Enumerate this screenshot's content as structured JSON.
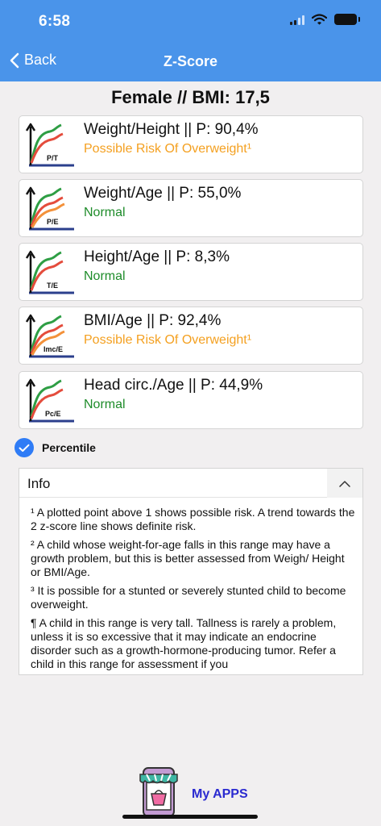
{
  "status_bar": {
    "time": "6:58"
  },
  "nav": {
    "back_label": "Back",
    "title": "Z-Score"
  },
  "page_title": "Female // BMI: 17,5",
  "colors": {
    "header": "#4a94ea",
    "normal": "#1e8c2a",
    "risk": "#f4a020",
    "checkbox": "#2f7cf6",
    "apps_link": "#2a2ad0"
  },
  "cards": [
    {
      "icon_label": "P/T",
      "title": "Weight/Height  ||  P: 90,4%",
      "status": "Possible Risk Of Overweight¹",
      "status_type": "risk",
      "icon": "growth-chart-icon"
    },
    {
      "icon_label": "P/E",
      "title": "Weight/Age  ||  P: 55,0%",
      "status": "Normal",
      "status_type": "normal",
      "icon": "growth-chart-icon"
    },
    {
      "icon_label": "T/E",
      "title": "Height/Age  ||  P: 8,3%",
      "status": "Normal",
      "status_type": "normal",
      "icon": "growth-chart-icon"
    },
    {
      "icon_label": "Imc/E",
      "title": "BMI/Age   ||  P: 92,4%",
      "status": "Possible Risk Of Overweight¹",
      "status_type": "risk",
      "icon": "growth-chart-icon"
    },
    {
      "icon_label": "Pc/E",
      "title": "Head circ./Age ||  P: 44,9%",
      "status": "Normal",
      "status_type": "normal",
      "icon": "growth-chart-icon"
    }
  ],
  "percentile": {
    "label": "Percentile",
    "checked": true
  },
  "info": {
    "title": "Info",
    "paragraphs": [
      "¹ A plotted point above 1 shows possible risk. A trend towards the 2 z-score line shows definite risk.",
      "² A child whose weight-for-age falls in this range may have a growth problem, but this is better assessed from Weigh/ Height or BMI/Age.",
      "³ It is possible for a stunted or severely stunted child to become overweight.",
      "¶ A child in this range is very tall. Tallness is rarely a problem, unless it is so excessive that it may indicate an endocrine disorder such as a growth-hormone-producing tumor. Refer a child in this range for assessment if you"
    ]
  },
  "apps": {
    "label": "My APPS",
    "icon": "shop-phone-icon"
  }
}
